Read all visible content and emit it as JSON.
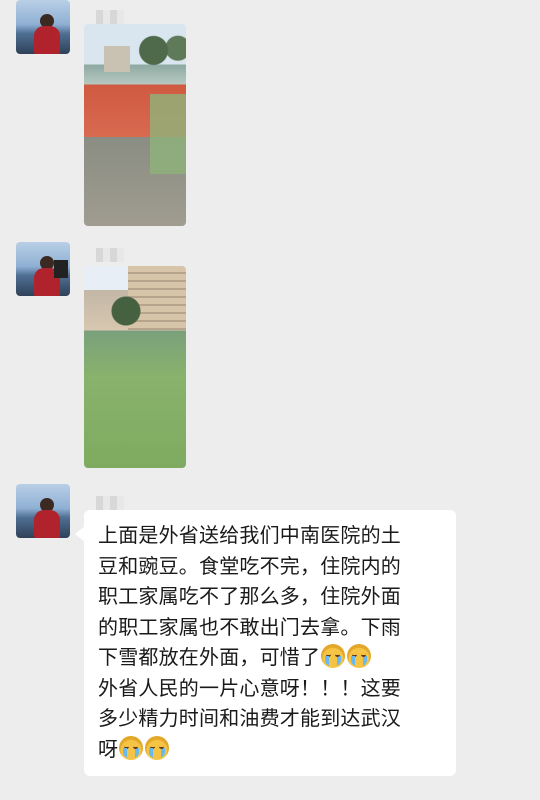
{
  "messages": [
    {
      "type": "image",
      "content": "potatoes pile photo"
    },
    {
      "type": "image",
      "content": "grass field with buildings photo"
    },
    {
      "type": "text",
      "lines": [
        "上面是外省送给我们中南医院的土",
        "豆和豌豆。食堂吃不完，住院内的",
        "职工家属吃不了那么多，住院外面",
        "的职工家属也不敢出门去拿。下雨",
        "下雪都放在外面，可惜了",
        "外省人民的一片心意呀！！！这要",
        "多少精力时间和油费才能到达武汉",
        "呀"
      ],
      "emoji": "crying-face"
    }
  ],
  "colors": {
    "background": "#ededed",
    "bubble": "#ffffff",
    "text": "#1a1a1a"
  }
}
